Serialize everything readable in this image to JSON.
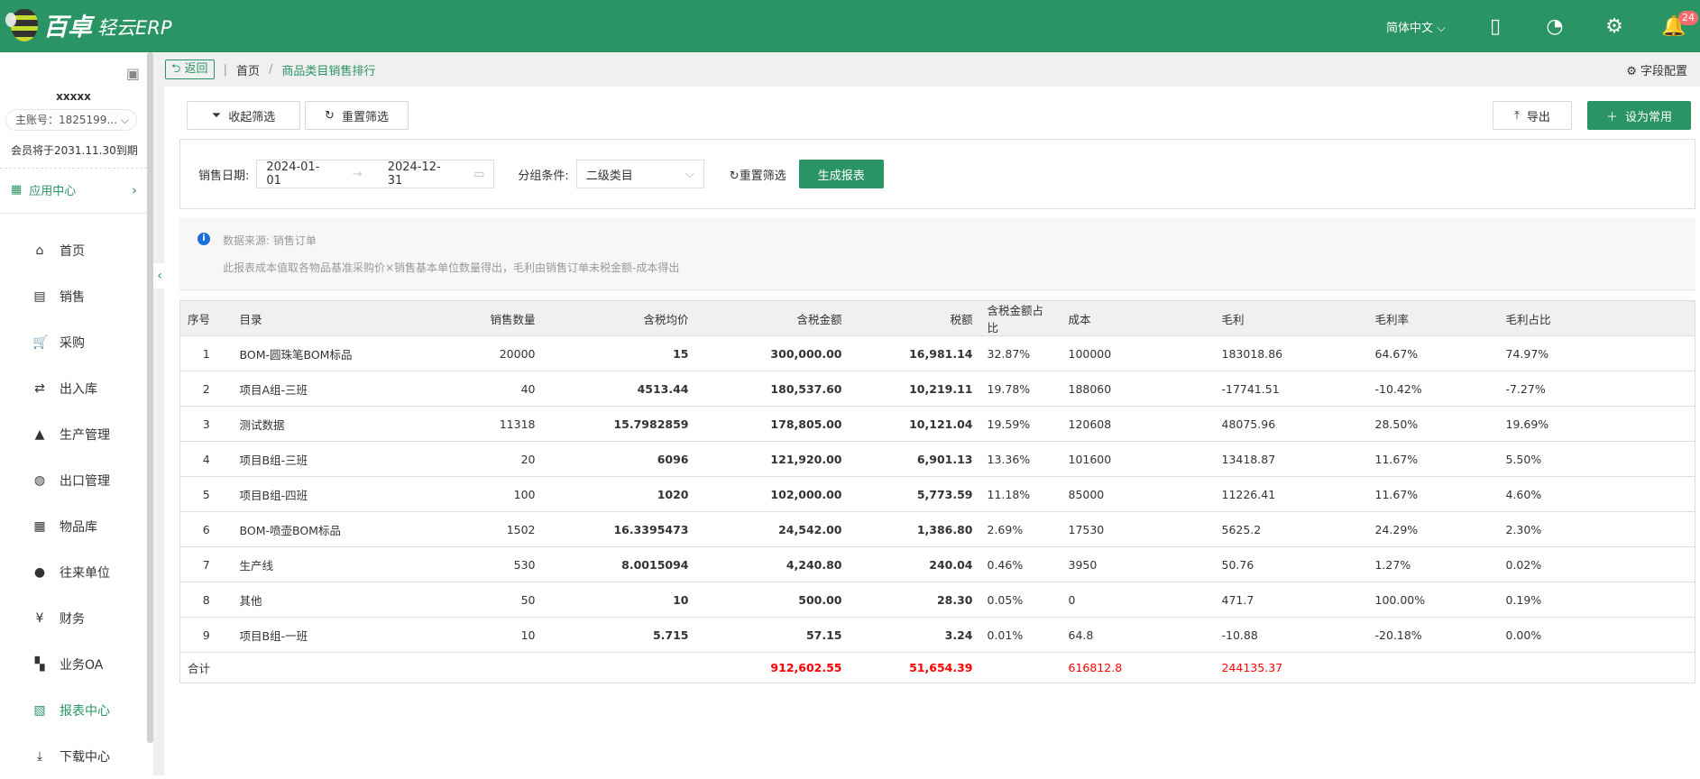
{
  "header": {
    "logo_main": "百卓",
    "logo_sub": "轻云ERP",
    "language": "简体中文",
    "notification_count": "24"
  },
  "sidebar": {
    "username": "xxxxx",
    "account": "主账号：1825199...",
    "expire": "会员将于2031.11.30到期",
    "app_center": "应用中心",
    "items": [
      {
        "label": "首页",
        "icon": "home-icon",
        "glyph": "⌂"
      },
      {
        "label": "销售",
        "icon": "sales-icon",
        "glyph": "▤"
      },
      {
        "label": "采购",
        "icon": "cart-icon",
        "glyph": "🛒"
      },
      {
        "label": "出入库",
        "icon": "transfer-icon",
        "glyph": "⇄"
      },
      {
        "label": "生产管理",
        "icon": "factory-icon",
        "glyph": "▲"
      },
      {
        "label": "出口管理",
        "icon": "globe-icon",
        "glyph": "◍"
      },
      {
        "label": "物品库",
        "icon": "boxes-icon",
        "glyph": "▦"
      },
      {
        "label": "往来单位",
        "icon": "user-icon",
        "glyph": "●"
      },
      {
        "label": "财务",
        "icon": "yen-icon",
        "glyph": "¥"
      },
      {
        "label": "业务OA",
        "icon": "grid-icon",
        "glyph": "▚"
      },
      {
        "label": "报表中心",
        "icon": "report-icon",
        "glyph": "▧",
        "active": true
      },
      {
        "label": "下载中心",
        "icon": "download-icon",
        "glyph": "⤓"
      }
    ]
  },
  "breadcrumb": {
    "back": "返回",
    "home": "首页",
    "current": "商品类目销售排行",
    "field_config": "字段配置"
  },
  "toolbar": {
    "collapse_filter": "收起筛选",
    "reset_filter": "重置筛选",
    "export": "导出",
    "set_favorite": "设为常用"
  },
  "filter": {
    "date_label": "销售日期:",
    "date_start": "2024-01-01",
    "date_end": "2024-12-31",
    "group_label": "分组条件:",
    "group_value": "二级类目",
    "reset": "重置筛选",
    "generate": "生成报表"
  },
  "info": {
    "source": "数据来源: 销售订单",
    "note": "此报表成本值取各物品基准采购价×销售基本单位数量得出，毛利由销售订单未税金额-成本得出"
  },
  "table": {
    "columns": [
      "序号",
      "目录",
      "销售数量",
      "含税均价",
      "含税金额",
      "税额",
      "含税金额占比",
      "成本",
      "毛利",
      "毛利率",
      "毛利占比"
    ],
    "rows": [
      [
        "1",
        "BOM-圆珠笔BOM标品",
        "20000",
        "15",
        "300,000.00",
        "16,981.14",
        "32.87%",
        "100000",
        "183018.86",
        "64.67%",
        "74.97%"
      ],
      [
        "2",
        "项目A组-三班",
        "40",
        "4513.44",
        "180,537.60",
        "10,219.11",
        "19.78%",
        "188060",
        "-17741.51",
        "-10.42%",
        "-7.27%"
      ],
      [
        "3",
        "测试数据",
        "11318",
        "15.7982859",
        "178,805.00",
        "10,121.04",
        "19.59%",
        "120608",
        "48075.96",
        "28.50%",
        "19.69%"
      ],
      [
        "4",
        "项目B组-三班",
        "20",
        "6096",
        "121,920.00",
        "6,901.13",
        "13.36%",
        "101600",
        "13418.87",
        "11.67%",
        "5.50%"
      ],
      [
        "5",
        "项目B组-四班",
        "100",
        "1020",
        "102,000.00",
        "5,773.59",
        "11.18%",
        "85000",
        "11226.41",
        "11.67%",
        "4.60%"
      ],
      [
        "6",
        "BOM-喷壶BOM标品",
        "1502",
        "16.3395473",
        "24,542.00",
        "1,386.80",
        "2.69%",
        "17530",
        "5625.2",
        "24.29%",
        "2.30%"
      ],
      [
        "7",
        "生产线",
        "530",
        "8.0015094",
        "4,240.80",
        "240.04",
        "0.46%",
        "3950",
        "50.76",
        "1.27%",
        "0.02%"
      ],
      [
        "8",
        "其他",
        "50",
        "10",
        "500.00",
        "28.30",
        "0.05%",
        "0",
        "471.7",
        "100.00%",
        "0.19%"
      ],
      [
        "9",
        "项目B组-一班",
        "10",
        "5.715",
        "57.15",
        "3.24",
        "0.01%",
        "64.8",
        "-10.88",
        "-20.18%",
        "0.00%"
      ]
    ],
    "total": {
      "label": "合计",
      "amount": "912,602.55",
      "tax": "51,654.39",
      "cost": "616812.8",
      "profit": "244135.37"
    }
  },
  "colors": {
    "brand": "#2b9465",
    "total": "#ff0000"
  }
}
